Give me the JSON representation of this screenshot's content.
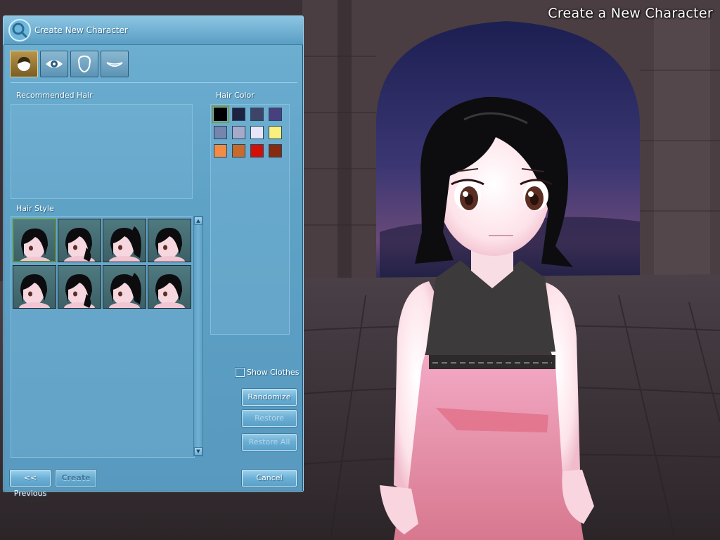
{
  "screen_title": "Create a New Character",
  "panel": {
    "title": "Create New Character",
    "tabs": [
      {
        "icon": "hair-icon",
        "active": true
      },
      {
        "icon": "eye-icon",
        "active": false
      },
      {
        "icon": "face-icon",
        "active": false
      },
      {
        "icon": "mouth-icon",
        "active": false
      }
    ]
  },
  "recommended_hair": {
    "label": "Recommended Hair"
  },
  "hair_style": {
    "label": "Hair Style",
    "thumbnail_count": 8,
    "selected_index": 0
  },
  "hair_color": {
    "label": "Hair Color",
    "selected_index": 0,
    "swatches": [
      "#000000",
      "#1e2240",
      "#3e4468",
      "#4a3f7e",
      "#7486ae",
      "#a6aac8",
      "#e6e6f8",
      "#fbf07e",
      "#f28c44",
      "#c86a2c",
      "#d21008",
      "#882a10"
    ]
  },
  "options": {
    "show_clothes_label": "Show Clothes",
    "show_clothes_checked": false
  },
  "buttons": {
    "randomize": "Randomize",
    "restore": "Restore",
    "restore_all": "Restore All",
    "previous": "<< Previous",
    "create": "Create",
    "cancel": "Cancel"
  }
}
